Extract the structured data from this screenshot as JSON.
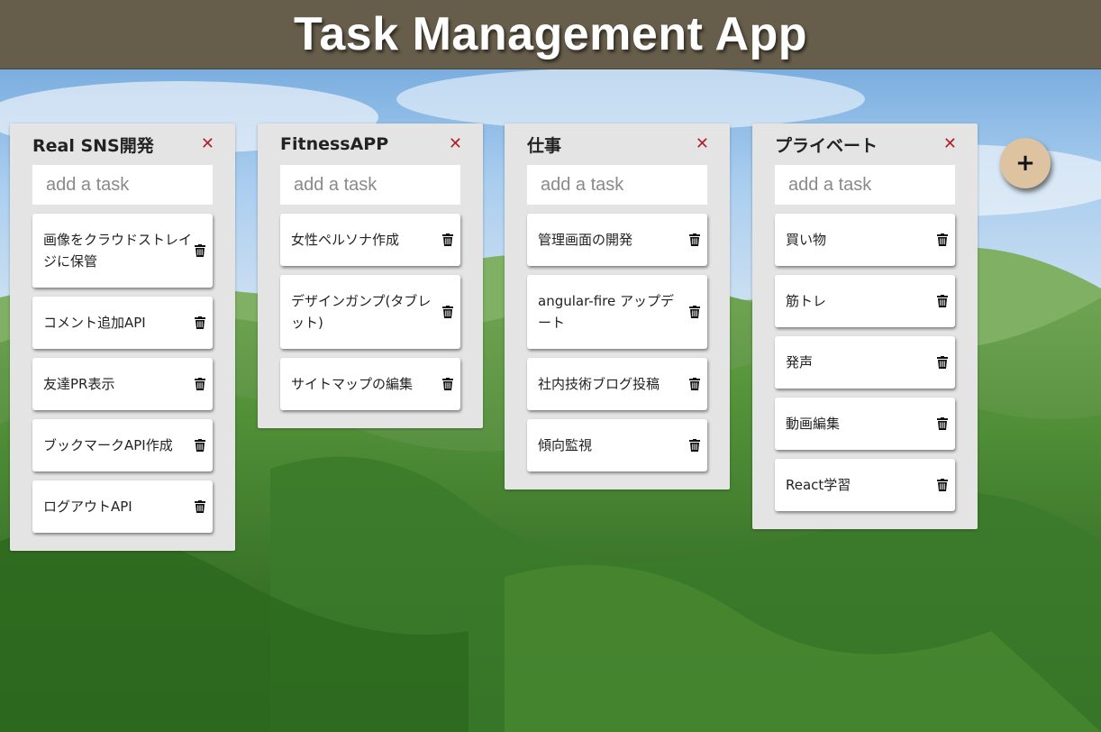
{
  "app": {
    "title": "Task Management App"
  },
  "add_list_label": "+",
  "lists": [
    {
      "title": "Real SNS開発",
      "close": "✕",
      "placeholder": "add a task",
      "tasks": [
        "画像をクラウドストレイジに保管",
        "コメント追加API",
        "友達PR表示",
        "ブックマークAPI作成",
        "ログアウトAPI"
      ]
    },
    {
      "title": "FitnessAPP",
      "close": "✕",
      "placeholder": "add a task",
      "tasks": [
        "女性ペルソナ作成",
        "デザインガンプ(タブレット)",
        "サイトマップの編集"
      ]
    },
    {
      "title": "仕事",
      "close": "✕",
      "placeholder": "add a task",
      "tasks": [
        "管理画面の開発",
        "angular-fire アップデート",
        "社内技術ブログ投稿",
        "傾向監視"
      ]
    },
    {
      "title": "プライベート",
      "close": "✕",
      "placeholder": "add a task",
      "tasks": [
        "買い物",
        "筋トレ",
        "発声",
        "動画編集",
        "React学習"
      ]
    }
  ],
  "colors": {
    "header": "#665d4a",
    "list_bg": "#e4e4e4",
    "close": "#b0212a",
    "add_button": "#ddc39f"
  },
  "icons": {
    "delete": "trash-icon",
    "close": "close-icon",
    "add": "plus-icon"
  }
}
